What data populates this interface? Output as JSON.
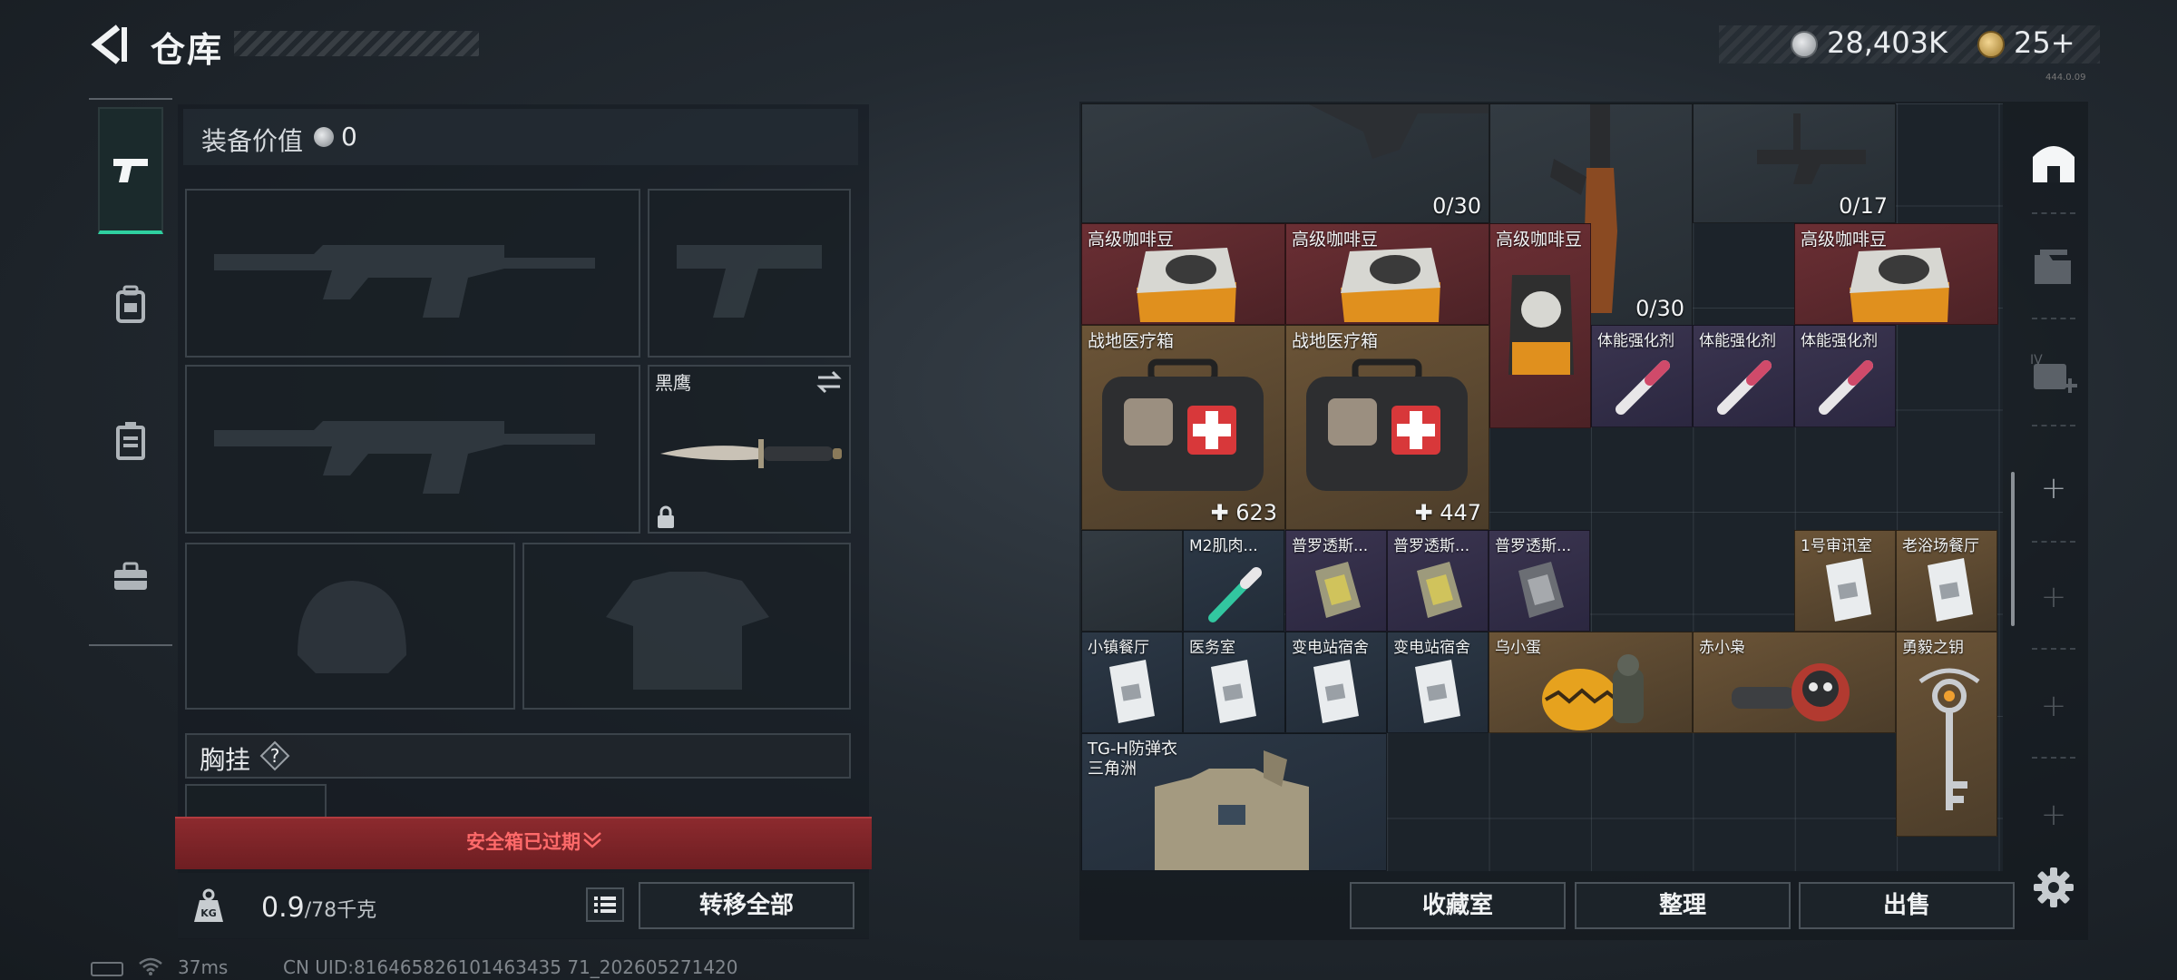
{
  "header": {
    "title": "仓库",
    "money": "28,403K",
    "tickets": "25+",
    "tiny_text": "444.0.09"
  },
  "equipment": {
    "value_label": "装备价值",
    "value_amount": "0",
    "knife_name": "黑鹰",
    "chest_label": "胸挂",
    "help_mark": "?",
    "safebox_status": "安全箱已过期",
    "weight_value": "0.9",
    "weight_max": "/78千克",
    "transfer_all": "转移全部"
  },
  "storage": {
    "items": [
      {
        "name": "",
        "count": "0/30",
        "quality": "gray"
      },
      {
        "name": "",
        "count": "0/30",
        "quality": "gray"
      },
      {
        "name": "",
        "count": "0/17",
        "quality": "gray"
      },
      {
        "name": "高级咖啡豆",
        "count": "",
        "quality": "red"
      },
      {
        "name": "高级咖啡豆",
        "count": "",
        "quality": "red"
      },
      {
        "name": "高级咖啡豆",
        "count": "",
        "quality": "red"
      },
      {
        "name": "高级咖啡豆",
        "count": "",
        "quality": "red"
      },
      {
        "name": "战地医疗箱",
        "count": "623",
        "quality": "gold"
      },
      {
        "name": "战地医疗箱",
        "count": "447",
        "quality": "gold"
      },
      {
        "name": "体能强化剂",
        "count": "",
        "quality": "purple"
      },
      {
        "name": "体能强化剂",
        "count": "",
        "quality": "purple"
      },
      {
        "name": "体能强化剂",
        "count": "",
        "quality": "purple"
      },
      {
        "name": "M2肌肉...",
        "count": "",
        "quality": "blue"
      },
      {
        "name": "普罗透斯...",
        "count": "",
        "quality": "purple"
      },
      {
        "name": "普罗透斯...",
        "count": "",
        "quality": "purple"
      },
      {
        "name": "普罗透斯...",
        "count": "",
        "quality": "purple"
      },
      {
        "name": "1号审讯室",
        "count": "",
        "quality": "gold"
      },
      {
        "name": "老浴场餐厅",
        "count": "",
        "quality": "gold"
      },
      {
        "name": "小镇餐厅",
        "count": "",
        "quality": "blue"
      },
      {
        "name": "医务室",
        "count": "",
        "quality": "blue"
      },
      {
        "name": "变电站宿舍",
        "count": "",
        "quality": "blue"
      },
      {
        "name": "变电站宿舍",
        "count": "",
        "quality": "blue"
      },
      {
        "name": "乌小蛋",
        "count": "",
        "quality": "gold"
      },
      {
        "name": "赤小枭",
        "count": "",
        "quality": "gold"
      },
      {
        "name": "勇毅之钥",
        "count": "",
        "quality": "gold"
      },
      {
        "name": "TG-H防弹衣",
        "subname": "三角洲",
        "count": "",
        "quality": "blue"
      }
    ]
  },
  "actions": {
    "collection": "收藏室",
    "arrange": "整理",
    "sell": "出售"
  },
  "status_bar": {
    "ping": "37ms",
    "uid": "CN UID:816465826101463435 71_202605271420"
  },
  "colors": {
    "accent": "#2fd0a0",
    "danger": "#b23a3e",
    "quality_gold": "#6b5437",
    "quality_red": "#6b2f34",
    "quality_purple": "#3b3550",
    "quality_blue": "#2c3846"
  }
}
